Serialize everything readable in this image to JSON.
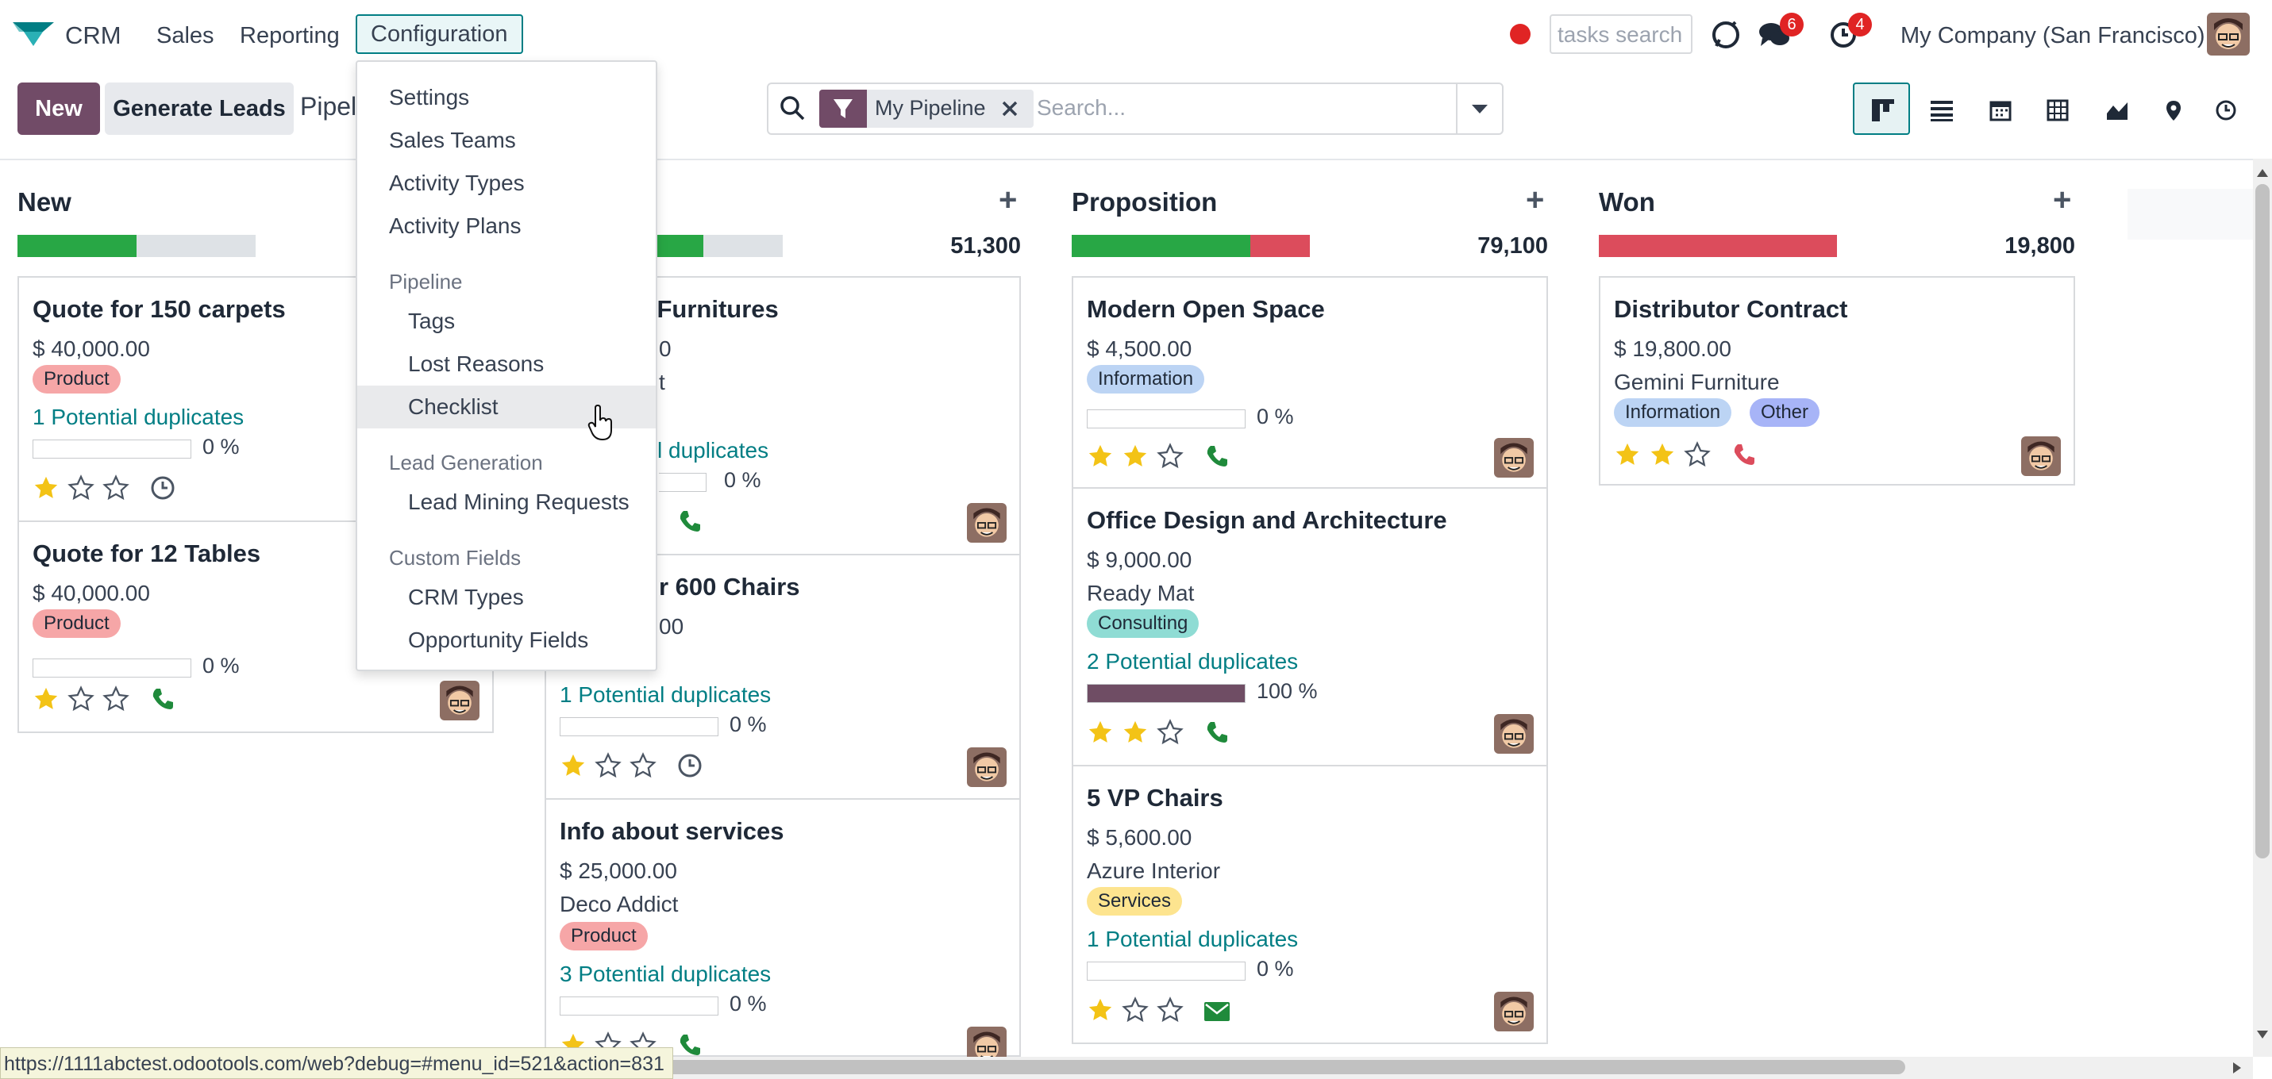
{
  "navbar": {
    "app_name": "CRM",
    "menus": [
      "Sales",
      "Reporting",
      "Configuration"
    ],
    "search_placeholder": "tasks search",
    "messages_count": "6",
    "activities_count": "4",
    "company": "My Company (San Francisco)"
  },
  "control_panel": {
    "new_label": "New",
    "generate_label": "Generate Leads",
    "breadcrumb": "Pipel",
    "facet_label": "My Pipeline",
    "search_placeholder": "Search..."
  },
  "dropdown": {
    "items_top": [
      "Settings",
      "Sales Teams",
      "Activity Types",
      "Activity Plans"
    ],
    "pipeline_header": "Pipeline",
    "pipeline_items": [
      "Tags",
      "Lost Reasons",
      "Checklist"
    ],
    "lead_header": "Lead Generation",
    "lead_items": [
      "Lead Mining Requests"
    ],
    "custom_header": "Custom Fields",
    "custom_items": [
      "CRM Types",
      "Opportunity Fields"
    ]
  },
  "columns": [
    {
      "title": "New",
      "progress": {
        "green": 0.5,
        "red": 0.0
      },
      "cards": [
        {
          "title": "Quote for 150 carpets",
          "amount": "$ 40,000.00",
          "tags": [
            {
              "label": "Product",
              "color": "#f6a6a7"
            }
          ],
          "link": "1 Potential duplicates",
          "progress": "0 %",
          "stars": 1,
          "activity": "clock"
        },
        {
          "title": "Quote for 12 Tables",
          "amount": "$ 40,000.00",
          "tags": [
            {
              "label": "Product",
              "color": "#f6a6a7"
            }
          ],
          "progress": "0 %",
          "stars": 1,
          "activity": "phone"
        }
      ]
    },
    {
      "total": "51,300",
      "progress": {
        "green": 0.5,
        "red": 0.0
      },
      "cards": [
        {
          "title": "olutions: Furnitures",
          "amount_partial": "0",
          "partner_partial": "t",
          "link": "l duplicates",
          "progress": "0 %",
          "activity": "phone"
        },
        {
          "title": "r 600 Chairs",
          "amount_partial": "00",
          "link": "1 Potential duplicates",
          "progress": "0 %",
          "stars": 1,
          "activity": "clock"
        },
        {
          "title": "Info about services",
          "amount": "$ 25,000.00",
          "partner": "Deco Addict",
          "tags": [
            {
              "label": "Product",
              "color": "#f6a6a7"
            }
          ],
          "link": "3 Potential duplicates",
          "progress": "0 %",
          "stars": 1,
          "activity": "phone"
        }
      ]
    },
    {
      "title": "Proposition",
      "total": "79,100",
      "progress": {
        "green": 0.75,
        "red": 0.25
      },
      "cards": [
        {
          "title": "Modern Open Space",
          "amount": "$ 4,500.00",
          "tags": [
            {
              "label": "Information",
              "color": "#bcd4f4"
            }
          ],
          "progress": "0 %",
          "stars": 2,
          "activity": "phone"
        },
        {
          "title": "Office Design and Architecture",
          "amount": "$ 9,000.00",
          "partner": "Ready Mat",
          "tags": [
            {
              "label": "Consulting",
              "color": "#8fdcd4"
            }
          ],
          "link": "2 Potential duplicates",
          "progress": "100 %",
          "progress_value": 1.0,
          "stars": 2,
          "activity": "phone"
        },
        {
          "title": "5 VP Chairs",
          "amount": "$ 5,600.00",
          "partner": "Azure Interior",
          "tags": [
            {
              "label": "Services",
              "color": "#fde48f"
            }
          ],
          "link": "1 Potential duplicates",
          "progress": "0 %",
          "stars": 1,
          "activity": "mail"
        }
      ]
    },
    {
      "title": "Won",
      "total": "19,800",
      "progress": {
        "green": 0.0,
        "red": 1.0
      },
      "cards": [
        {
          "title": "Distributor Contract",
          "amount": "$ 19,800.00",
          "partner": "Gemini Furniture",
          "tags": [
            {
              "label": "Information",
              "color": "#bcd4f4"
            },
            {
              "label": "Other",
              "color": "#a7b4f7"
            }
          ],
          "stars": 2,
          "activity": "phone-red"
        }
      ]
    }
  ],
  "status_url": "https://1111abctest.odootools.com/web?debug=#menu_id=521&action=831",
  "colors": {
    "brand": "#714b67",
    "accent": "#017e84",
    "green": "#28a745",
    "red": "#dc4c5c",
    "star": "#f3c316"
  }
}
